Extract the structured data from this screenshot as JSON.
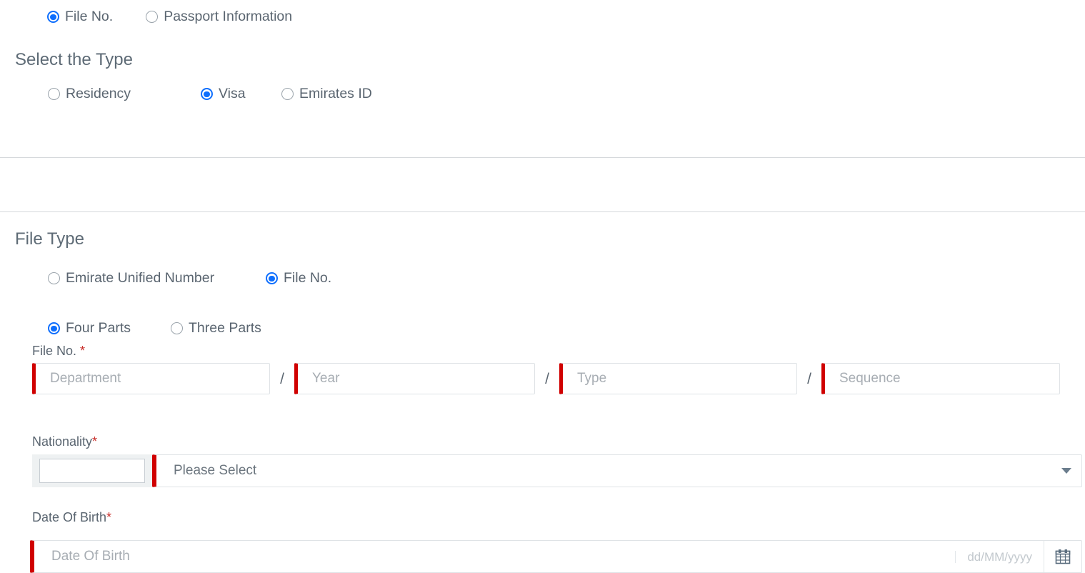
{
  "search_mode": {
    "options": [
      {
        "label": "File No.",
        "selected": true
      },
      {
        "label": "Passport Information",
        "selected": false
      }
    ]
  },
  "select_type": {
    "heading": "Select the Type",
    "options": [
      {
        "label": "Residency",
        "selected": false
      },
      {
        "label": "Visa",
        "selected": true
      },
      {
        "label": "Emirates ID",
        "selected": false
      }
    ]
  },
  "file_type": {
    "heading": "File Type",
    "options": [
      {
        "label": "Emirate Unified Number",
        "selected": false
      },
      {
        "label": "File No.",
        "selected": true
      }
    ],
    "parts_options": [
      {
        "label": "Four Parts",
        "selected": true
      },
      {
        "label": "Three Parts",
        "selected": false
      }
    ],
    "file_no_label": "File No. ",
    "required_mark": "*",
    "separator": "/",
    "fields": [
      {
        "placeholder": "Department",
        "value": ""
      },
      {
        "placeholder": "Year",
        "value": ""
      },
      {
        "placeholder": "Type",
        "value": ""
      },
      {
        "placeholder": "Sequence",
        "value": ""
      }
    ]
  },
  "nationality": {
    "label": "Nationality",
    "required_mark": "*",
    "selected_value": "Please Select",
    "flag_value": ""
  },
  "date_of_birth": {
    "label": "Date Of Birth",
    "required_mark": "*",
    "placeholder": "Date Of Birth",
    "value": "",
    "format_hint": "dd/MM/yyyy",
    "calendar_icon": "calendar-icon"
  },
  "colors": {
    "accent_blue": "#0d6efd",
    "required_red": "#d00000",
    "asterisk_red": "#c9302c",
    "text_gray": "#5a6570",
    "placeholder_gray": "#a7adb3",
    "divider_gray": "#d6d9dc"
  }
}
